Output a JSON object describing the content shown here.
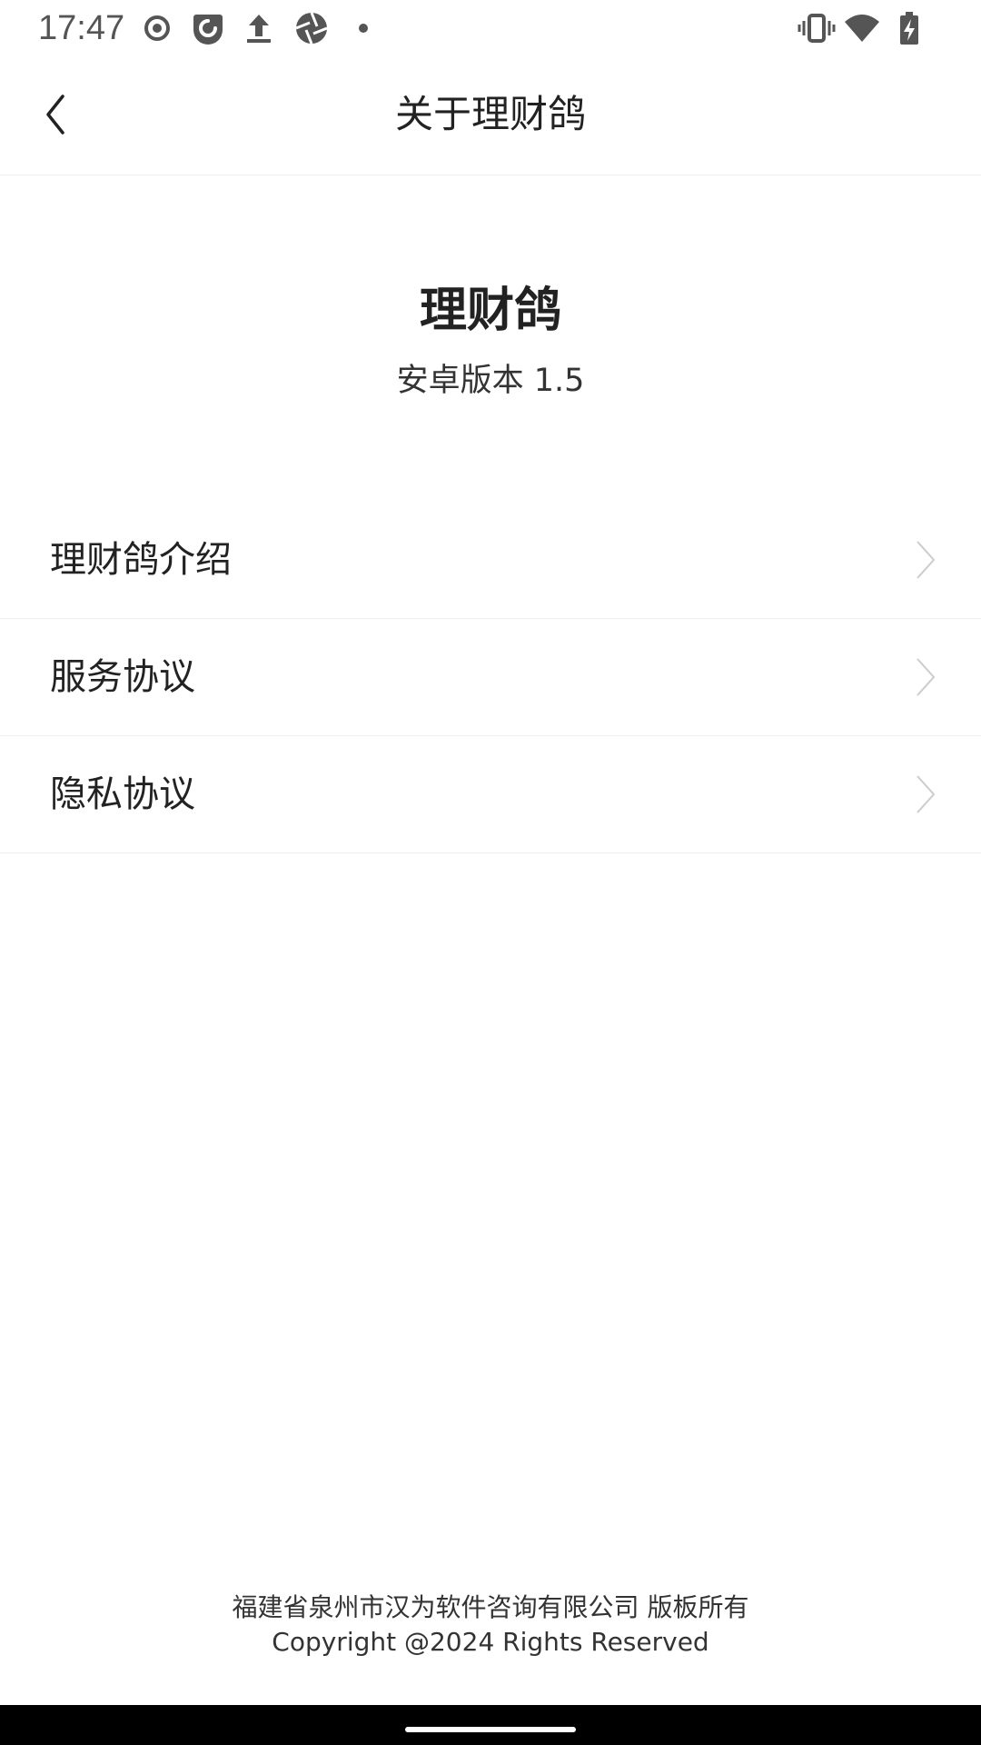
{
  "status_bar": {
    "time": "17:47",
    "icons_left": [
      "record-icon",
      "notification-app-icon",
      "upload-icon",
      "aperture-icon",
      "dot-icon"
    ],
    "icons_right": [
      "vibrate-icon",
      "wifi-icon",
      "battery-charging-icon"
    ]
  },
  "header": {
    "title": "关于理财鸽",
    "back_icon": "chevron-left-icon"
  },
  "app_info": {
    "name": "理财鸽",
    "version": "安卓版本 1.5"
  },
  "menu": {
    "items": [
      {
        "label": "理财鸽介绍"
      },
      {
        "label": "服务协议"
      },
      {
        "label": "隐私协议"
      }
    ]
  },
  "footer": {
    "company": "福建省泉州市汉为软件咨询有限公司 版板所有",
    "copyright": "Copyright @2024 Rights Reserved"
  },
  "colors": {
    "background": "#ffffff",
    "text": "#222222",
    "divider": "#eeeeee",
    "chevron": "#cccccc",
    "nav_bar": "#000000"
  }
}
